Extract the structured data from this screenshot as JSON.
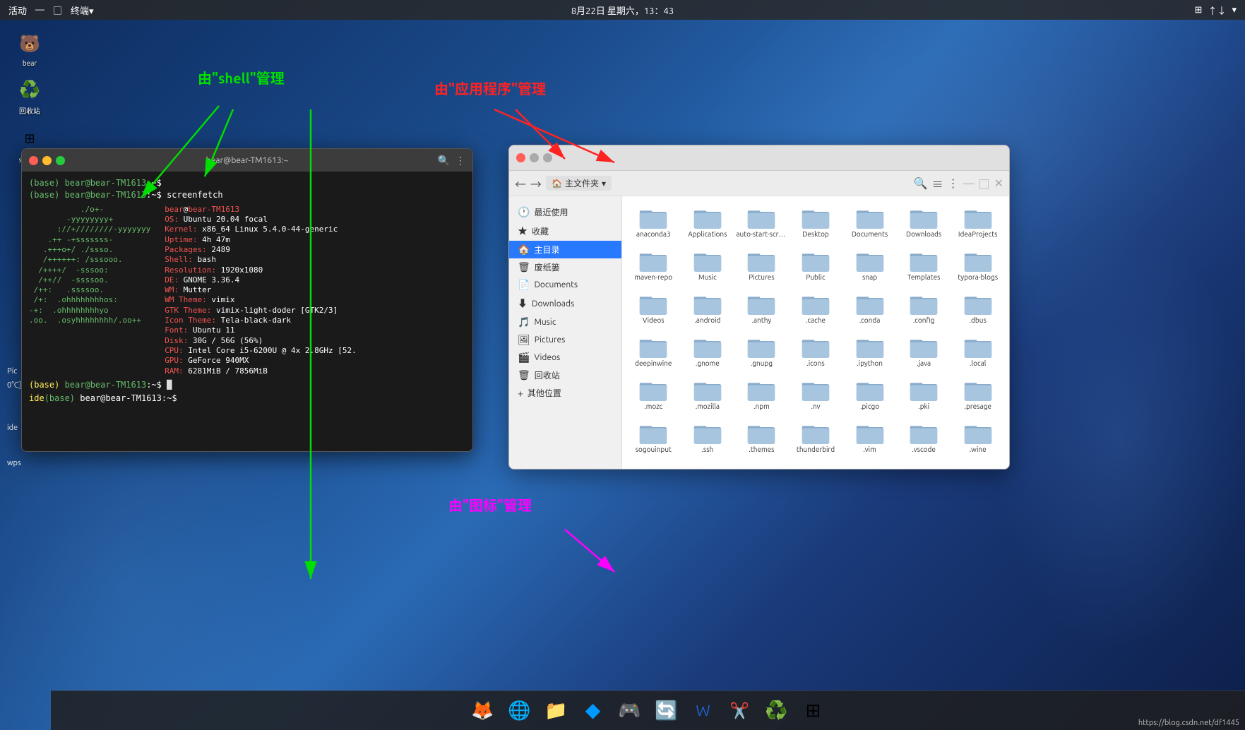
{
  "topbar": {
    "left": {
      "activities": "活动",
      "separator": "—",
      "terminal_icon": "□",
      "terminal_label": "终端▾"
    },
    "center": {
      "datetime": "8月22日 星期六，13：43"
    },
    "right": {
      "icons": [
        "⊞",
        "↑↓",
        "▾"
      ]
    }
  },
  "desktop_icons": [
    {
      "name": "bear-icon",
      "label": "bear",
      "emoji": "🐻"
    },
    {
      "name": "recycle-icon",
      "label": "回收站",
      "emoji": "♻️"
    },
    {
      "name": "start-icon",
      "label": "start了",
      "emoji": "⊞"
    }
  ],
  "terminal": {
    "title": "bear@bear-TM1613:~",
    "lines": [
      "(base) bear@bear-TM1613:~$",
      "(base) bear@bear-TM1613:~$ screenfetch",
      "",
      "OS: Ubuntu 20.04 focal",
      "Kernel: x86_64 Linux 5.4.0-44-generic",
      "Uptime: 4h 47m",
      "Packages: 2489",
      "Shell: bash",
      "Resolution: 1920x1080",
      "DE: GNOME 3.36.4",
      "WM: Mutter",
      "WM Theme: vimix",
      "GTK Theme: vimix-light-doder [GTK2/3]",
      "Icon Theme: Tela-black-dark",
      "Font: Ubuntu 11",
      "Disk: 30G / 56G (56%)",
      "CPU: Intel Core i5-6200U @ 4x 2.8GHz [52.",
      "GPU: GeForce 940MX",
      "RAM: 6281MiB / 7856MiB"
    ],
    "prompt_final": "(base) bear@bear-TM1613:~$"
  },
  "filemanager": {
    "title": "主文件夹",
    "sidebar_items": [
      {
        "icon": "🕐",
        "label": "最近使用"
      },
      {
        "icon": "★",
        "label": "收藏"
      },
      {
        "icon": "🏠",
        "label": "主目录",
        "active": true
      },
      {
        "icon": "🗑",
        "label": "废纸篓"
      },
      {
        "icon": "📄",
        "label": "Documents"
      },
      {
        "icon": "⬇",
        "label": "Downloads"
      },
      {
        "icon": "🎵",
        "label": "Music"
      },
      {
        "icon": "🖼",
        "label": "Pictures"
      },
      {
        "icon": "🎬",
        "label": "Videos"
      },
      {
        "icon": "🗑",
        "label": "回收站"
      },
      {
        "icon": "+",
        "label": "其他位置"
      }
    ],
    "files": [
      {
        "name": "anaconda3",
        "type": "folder"
      },
      {
        "name": "Applications",
        "type": "folder"
      },
      {
        "name": "auto-start-scripts",
        "type": "folder"
      },
      {
        "name": "Desktop",
        "type": "folder"
      },
      {
        "name": "Documents",
        "type": "folder"
      },
      {
        "name": "Downloads",
        "type": "folder"
      },
      {
        "name": "IdeaProjects",
        "type": "folder"
      },
      {
        "name": "maven-repo",
        "type": "folder",
        "icon": "special"
      },
      {
        "name": "Music",
        "type": "folder",
        "icon": "music"
      },
      {
        "name": "Pictures",
        "type": "folder"
      },
      {
        "name": "Public",
        "type": "folder"
      },
      {
        "name": "snap",
        "type": "folder"
      },
      {
        "name": "Templates",
        "type": "folder"
      },
      {
        "name": "typora-blogs",
        "type": "folder"
      },
      {
        "name": "Videos",
        "type": "folder",
        "icon": "video"
      },
      {
        "name": ".android",
        "type": "folder"
      },
      {
        "name": ".anthy",
        "type": "folder"
      },
      {
        "name": ".cache",
        "type": "folder"
      },
      {
        "name": ".conda",
        "type": "folder"
      },
      {
        "name": ".config",
        "type": "folder"
      },
      {
        "name": ".dbus",
        "type": "folder"
      },
      {
        "name": "deepinwine",
        "type": "folder"
      },
      {
        "name": ".gnome",
        "type": "folder"
      },
      {
        "name": ".gnupg",
        "type": "folder"
      },
      {
        "name": ".icons",
        "type": "folder"
      },
      {
        "name": ".ipython",
        "type": "folder"
      },
      {
        "name": ".java",
        "type": "folder"
      },
      {
        "name": ".local",
        "type": "folder"
      },
      {
        "name": ".mozc",
        "type": "folder"
      },
      {
        "name": ".mozilla",
        "type": "folder"
      },
      {
        "name": ".npm",
        "type": "folder"
      },
      {
        "name": ".nv",
        "type": "folder"
      },
      {
        "name": ".picgo",
        "type": "folder"
      },
      {
        "name": ".pki",
        "type": "folder"
      },
      {
        "name": ".presage",
        "type": "folder"
      },
      {
        "name": "sogouinput",
        "type": "folder"
      },
      {
        "name": ".ssh",
        "type": "folder"
      },
      {
        "name": ".themes",
        "type": "folder"
      },
      {
        "name": "thunderbird",
        "type": "folder"
      },
      {
        "name": ".vim",
        "type": "folder"
      },
      {
        "name": ".vscode",
        "type": "folder"
      },
      {
        "name": ".wine",
        "type": "folder"
      }
    ]
  },
  "annotations": {
    "shell_label": "由\"shell\"管理",
    "app_label": "由\"应用程序\"管理",
    "icon_label": "由\"图标\"管理"
  },
  "taskbar": {
    "icons": [
      "🦊",
      "🌐",
      "📁",
      "💙",
      "🎮",
      "🔄",
      "📝",
      "✂️",
      "♻️",
      "⊞"
    ]
  },
  "bottom_right": "https://blog.csdn.net/df1445"
}
